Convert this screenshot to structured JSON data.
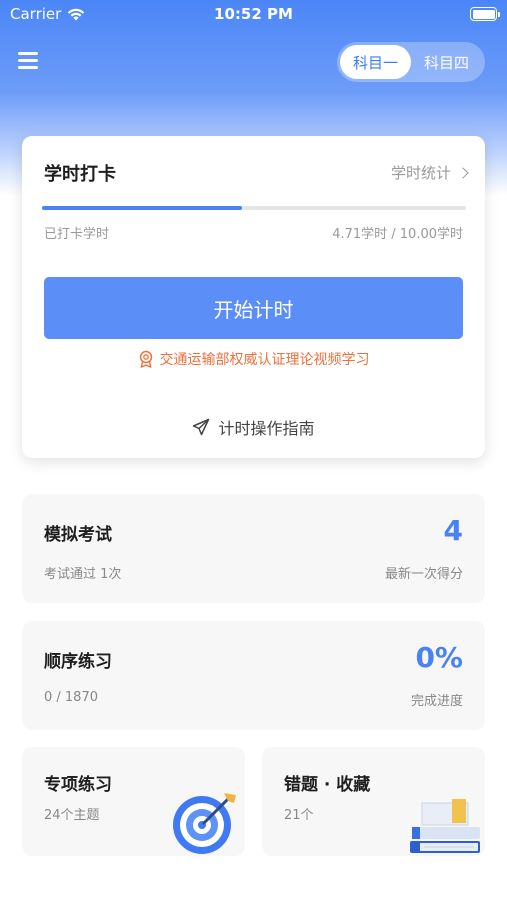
{
  "status_bar": {
    "carrier": "Carrier",
    "time": "10:52 PM"
  },
  "header": {
    "menu_icon": "menu-icon",
    "subjects": [
      "科目一",
      "科目四"
    ],
    "active_subject": "科目一"
  },
  "study_card": {
    "title": "学时打卡",
    "stats_link": "学时统计",
    "progress_label": "已打卡学时",
    "progress_value": "4.71学时 / 10.00学时",
    "progress_fraction": 0.471,
    "start_button": "开始计时",
    "certification_text": "交通运输部权威认证理论视频学习",
    "guide_text": "计时操作指南",
    "accent_color": "#5b8ff7",
    "cert_color": "#f0703a"
  },
  "mock_exam": {
    "title": "模拟考试",
    "subtitle": "考试通过 1次",
    "score": "4",
    "score_label": "最新一次得分"
  },
  "sequence_practice": {
    "title": "顺序练习",
    "subtitle": "0 / 1870",
    "progress": "0%",
    "progress_label": "完成进度"
  },
  "special_practice": {
    "title": "专项练习",
    "subtitle": "24个主题",
    "icon": "target-icon"
  },
  "mistakes": {
    "title": "错题 · 收藏",
    "subtitle": "21个",
    "icon": "books-icon"
  }
}
